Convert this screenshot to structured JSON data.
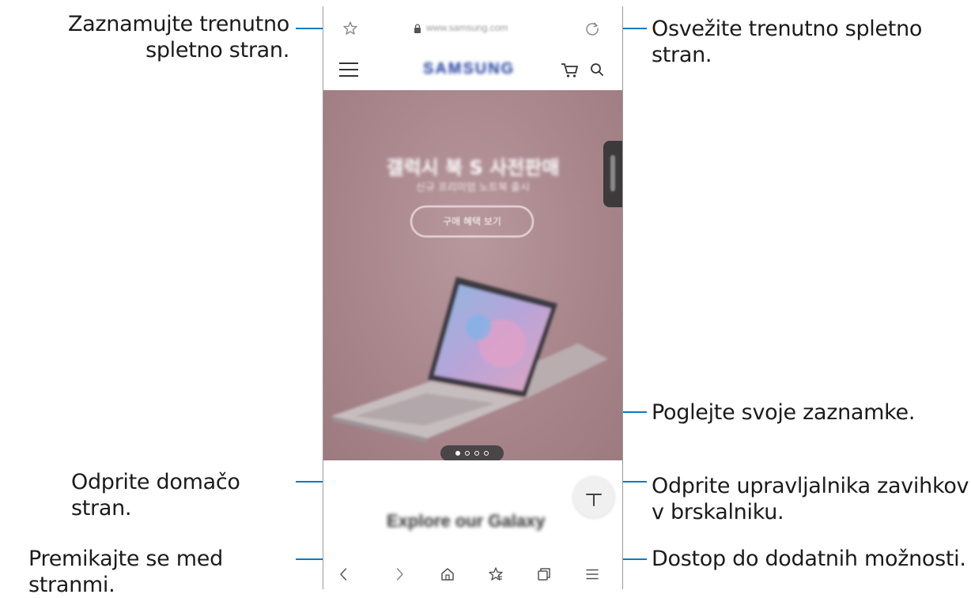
{
  "callouts": {
    "bookmark_current": "Zaznamujte trenutno spletno stran.",
    "refresh": "Osvežite trenutno spletno stran.",
    "view_bookmarks": "Poglejte svoje zaznamke.",
    "home": "Odprite domačo stran.",
    "tab_manager": "Odprite upravljalnika zavihkov v brskalniku.",
    "navigate": "Premikajte se med stranmi.",
    "more_options": "Dostop do dodatnih možnosti."
  },
  "browser": {
    "url": "www.samsung.com",
    "brand": "SAMSUNG",
    "hero_title": "갤럭시 북 S 사전판매",
    "hero_subtitle": "신규 프리미엄 노트북 출시",
    "hero_button": "구매 혜택 보기",
    "section_heading": "Explore our Galaxy",
    "carousel": {
      "total": 4,
      "active": 1
    }
  },
  "colors": {
    "leader_line": "#0a7bc0",
    "hero_bg": "#a8868c"
  },
  "icons": [
    "star-icon",
    "lock-icon",
    "reload-icon",
    "menu-icon",
    "cart-icon",
    "search-icon",
    "plus-icon",
    "back-icon",
    "forward-icon",
    "home-icon",
    "bookmarks-icon",
    "tabs-icon",
    "more-icon"
  ]
}
